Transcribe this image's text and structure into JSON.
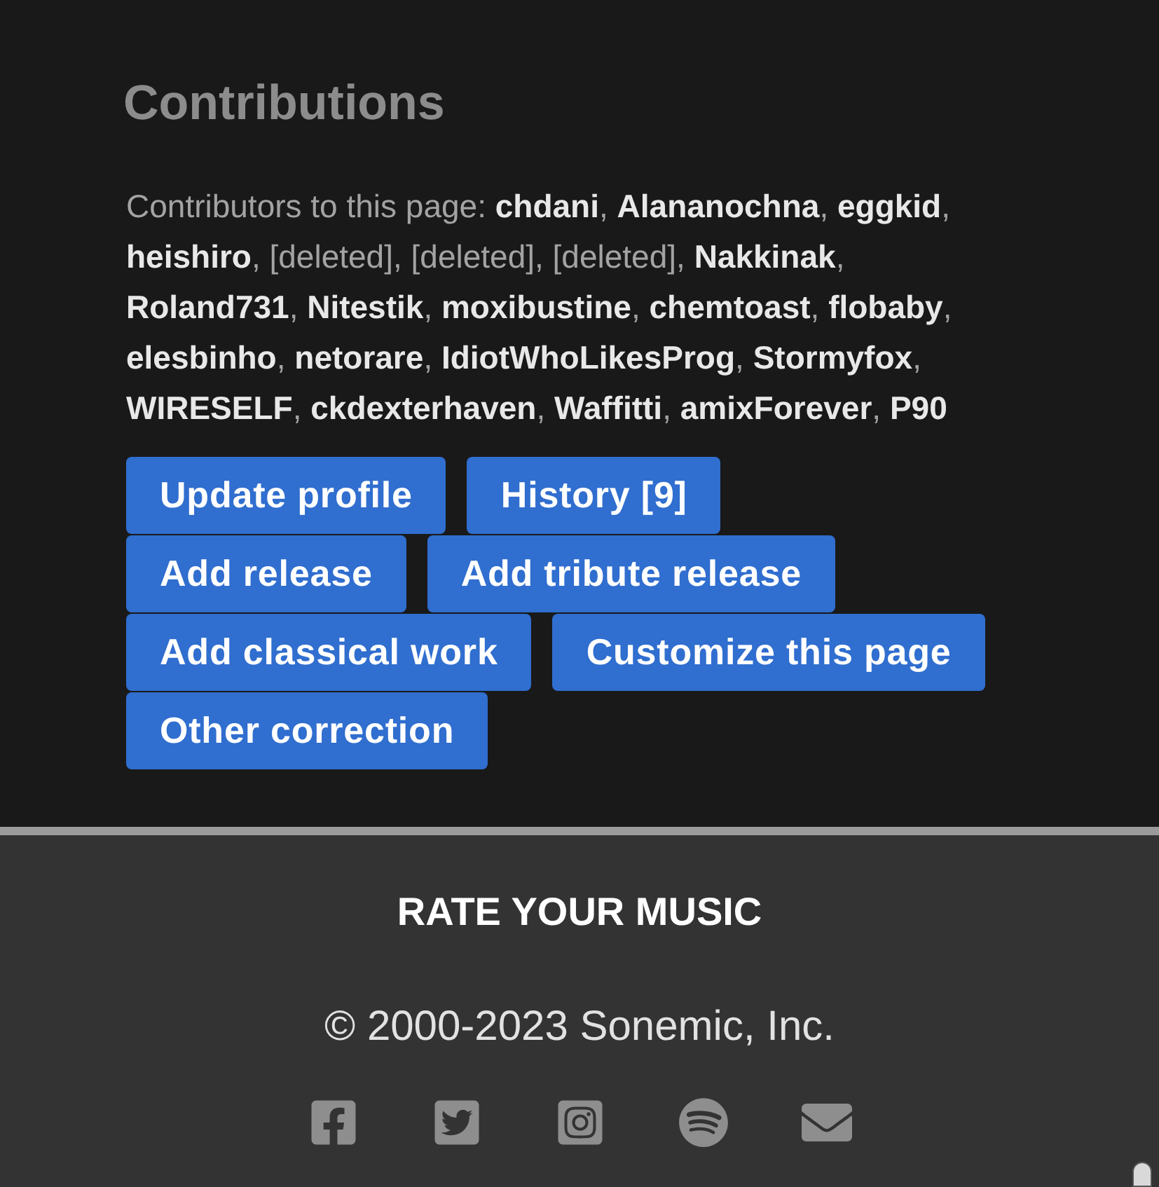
{
  "contributions": {
    "title": "Contributions",
    "contributors_text": "Contributors to this page: **chdani**, **Alananochna**, **eggkid**, **heishiro**, [deleted], [deleted], [deleted], **Nakkinak**, **Roland731**, **Nitestik**, **moxibustine**, **chemtoast**, **flobaby**, **elesbinho**, **netorare**, **IdiotWhoLikesProg**, **Stormyfox**, **WIRESELF**, **ckdexterhaven**, **Waffitti**, **amixForever**, **P90**",
    "buttons": [
      "Update profile",
      "History [9]",
      "Add release",
      "Add tribute release",
      "Add classical work",
      "Customize this page",
      "Other correction"
    ]
  },
  "footer": {
    "brand": "RATE YOUR MUSIC",
    "copyright": "© 2000-2023 Sonemic, Inc.",
    "social_links": [
      {
        "kind": "facebook"
      },
      {
        "kind": "twitter"
      },
      {
        "kind": "instagram"
      },
      {
        "kind": "spotify"
      },
      {
        "kind": "email"
      }
    ]
  }
}
